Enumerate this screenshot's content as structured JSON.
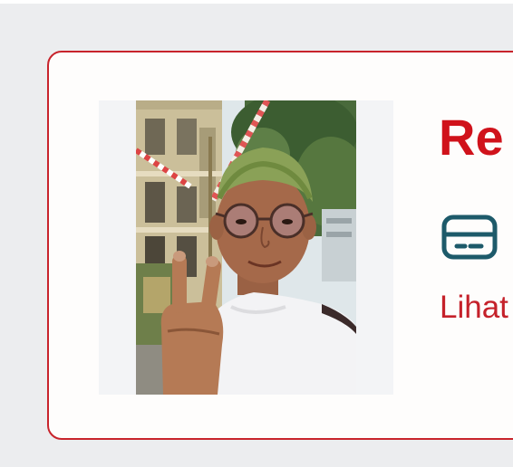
{
  "card": {
    "title": "Re",
    "link_text": "Lihat",
    "icon": "credit-card-icon",
    "photo_subject": "selfie-photo"
  },
  "colors": {
    "accent": "#c8242c",
    "title": "#d0121b",
    "icon": "#1d5a6a",
    "background": "#ecedef",
    "card_bg": "#fefdfc"
  }
}
